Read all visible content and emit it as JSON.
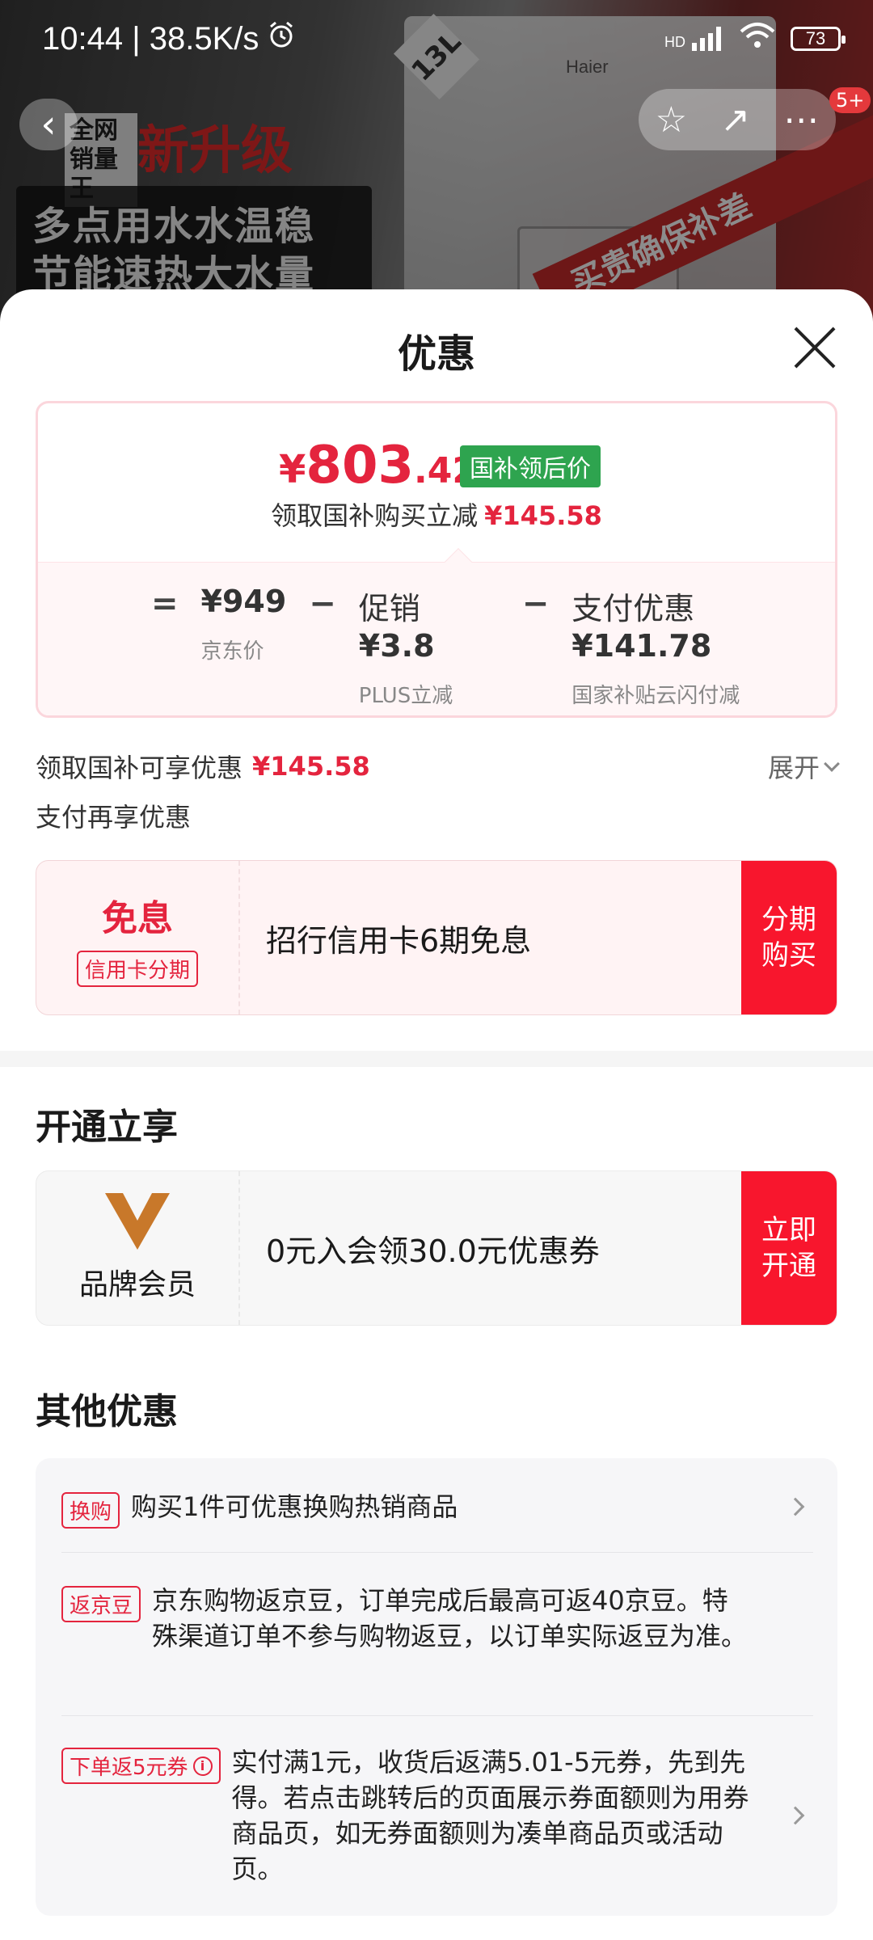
{
  "status_bar": {
    "time_speed": "10:44 | 38.5K/s",
    "alarm_icon": "alarm-icon",
    "network": "HD",
    "battery": "73"
  },
  "banner": {
    "size_tag": "13L",
    "brand": "Haier",
    "label_top": "全网销量王",
    "upgrade": "新升级",
    "line1": "多点用水水温稳",
    "line2": "节能速热大水量",
    "diag": "买贵确保补差"
  },
  "nav": {
    "cart_badge": "5+"
  },
  "sheet": {
    "title": "优惠"
  },
  "price_card": {
    "yen": "¥",
    "price_int": "803",
    "price_dec": ".42",
    "tag": "国补领后价",
    "reduce_text": "领取国补购买立减",
    "reduce_amount": "¥145.58",
    "eq": "=",
    "jd_price": "¥949",
    "jd_label": "京东价",
    "minus1": "−",
    "promo_label": "促销",
    "promo_value": "¥3.8",
    "promo_sub1": "PLUS立减",
    "promo_sub2": "¥3.8元",
    "minus2": "−",
    "pay_label": "支付优惠",
    "pay_value": "¥141.78",
    "pay_sub1": "国家补贴云闪付减",
    "pay_sub2": "¥141.78"
  },
  "qb_row": {
    "text": "领取国补可享优惠",
    "amount": "¥145.58",
    "expand": "展开"
  },
  "pay_again": "支付再享优惠",
  "installment_card": {
    "title": "免息",
    "tag": "信用卡分期",
    "desc": "招行信用卡6期免息",
    "cta": "分期购买"
  },
  "open_section": {
    "title": "开通立享"
  },
  "member_card": {
    "label": "品牌会员",
    "desc": "0元入会领30.0元优惠券",
    "cta": "立即开通"
  },
  "other_section": {
    "title": "其他优惠",
    "items": [
      {
        "tag": "换购",
        "text": "购买1件可优惠换购热销商品"
      },
      {
        "tag": "返京豆",
        "text": "京东购物返京豆，订单完成后最高可返40京豆。特殊渠道订单不参与购物返豆，以订单实际返豆为准。"
      },
      {
        "tag": "下单返5元券",
        "text": "实付满1元，收货后返满5.01-5元券，先到先得。若点击跳转后的页面展示券面额则为用券商品页，如无券面额则为凑单商品页或活动页。"
      }
    ]
  },
  "colors": {
    "accent_red": "#e4243e",
    "cta_red": "#f8162d",
    "green_tag": "#2ea44f"
  }
}
